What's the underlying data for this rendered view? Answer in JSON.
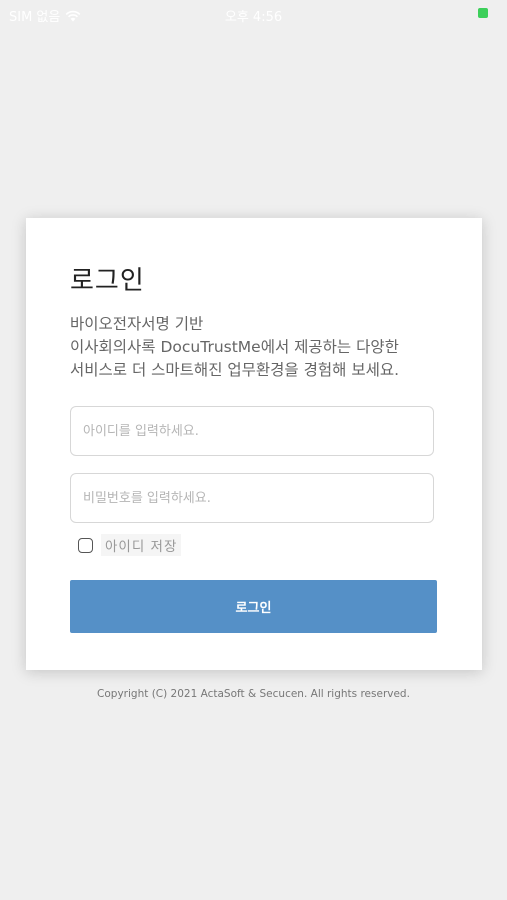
{
  "status_bar": {
    "carrier": "SIM 없음",
    "time": "오후 4:56",
    "battery_color": "#3ccf5a"
  },
  "login": {
    "title": "로그인",
    "description_lines": [
      "바이오전자서명 기반",
      "이사회의사록 DocuTrustMe에서 제공하는 다양한",
      "서비스로 더 스마트해진 업무환경을 경험해 보세요."
    ],
    "id_placeholder": "아이디를 입력하세요.",
    "password_placeholder": "비밀번호를 입력하세요.",
    "remember_label": "아이디 저장",
    "remember_checked": false,
    "login_button_label": "로그인",
    "accent_color": "#5590c7"
  },
  "footer": {
    "copyright": "Copyright (C) 2021 ActaSoft & Secucen. All rights reserved."
  }
}
